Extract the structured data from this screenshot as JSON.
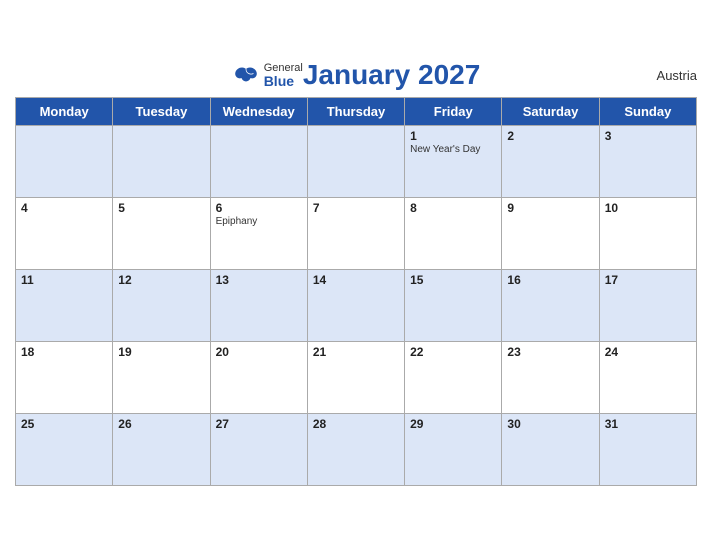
{
  "header": {
    "title": "January 2027",
    "country": "Austria",
    "logo": {
      "general": "General",
      "blue": "Blue"
    }
  },
  "days_of_week": [
    "Monday",
    "Tuesday",
    "Wednesday",
    "Thursday",
    "Friday",
    "Saturday",
    "Sunday"
  ],
  "weeks": [
    [
      {
        "day": "",
        "holiday": ""
      },
      {
        "day": "",
        "holiday": ""
      },
      {
        "day": "",
        "holiday": ""
      },
      {
        "day": "",
        "holiday": ""
      },
      {
        "day": "1",
        "holiday": "New Year's Day"
      },
      {
        "day": "2",
        "holiday": ""
      },
      {
        "day": "3",
        "holiday": ""
      }
    ],
    [
      {
        "day": "4",
        "holiday": ""
      },
      {
        "day": "5",
        "holiday": ""
      },
      {
        "day": "6",
        "holiday": "Epiphany"
      },
      {
        "day": "7",
        "holiday": ""
      },
      {
        "day": "8",
        "holiday": ""
      },
      {
        "day": "9",
        "holiday": ""
      },
      {
        "day": "10",
        "holiday": ""
      }
    ],
    [
      {
        "day": "11",
        "holiday": ""
      },
      {
        "day": "12",
        "holiday": ""
      },
      {
        "day": "13",
        "holiday": ""
      },
      {
        "day": "14",
        "holiday": ""
      },
      {
        "day": "15",
        "holiday": ""
      },
      {
        "day": "16",
        "holiday": ""
      },
      {
        "day": "17",
        "holiday": ""
      }
    ],
    [
      {
        "day": "18",
        "holiday": ""
      },
      {
        "day": "19",
        "holiday": ""
      },
      {
        "day": "20",
        "holiday": ""
      },
      {
        "day": "21",
        "holiday": ""
      },
      {
        "day": "22",
        "holiday": ""
      },
      {
        "day": "23",
        "holiday": ""
      },
      {
        "day": "24",
        "holiday": ""
      }
    ],
    [
      {
        "day": "25",
        "holiday": ""
      },
      {
        "day": "26",
        "holiday": ""
      },
      {
        "day": "27",
        "holiday": ""
      },
      {
        "day": "28",
        "holiday": ""
      },
      {
        "day": "29",
        "holiday": ""
      },
      {
        "day": "30",
        "holiday": ""
      },
      {
        "day": "31",
        "holiday": ""
      }
    ]
  ]
}
